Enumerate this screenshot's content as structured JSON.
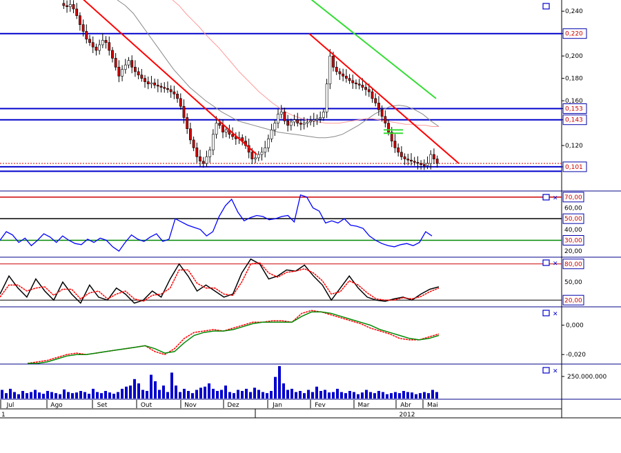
{
  "colors": {
    "price_up": "#ffffff",
    "price_down": "#cc0000",
    "candle_outline": "#000000",
    "support_resistance": "#0000cc",
    "trend_line": "#ff0000",
    "green_line": "#33dd33",
    "ma_fast": "#888888",
    "ma_slow": "#ff9999",
    "rsi_line": "#0000ff",
    "stoch_k": "#000000",
    "stoch_d": "#ff0000",
    "macd_line": "#ff0000",
    "signal_line": "#008800",
    "volume_bar": "#0000cc"
  },
  "icons": [
    "window-icon",
    "close-icon"
  ],
  "chart_data": [
    {
      "type": "candlestick",
      "panel": "price",
      "y_ticks": [
        "0,240",
        "0,220",
        "0,200",
        "0,180",
        "0,160",
        "0,153",
        "0,143",
        "0,120",
        "0,101"
      ],
      "price_labels": [
        {
          "value": "0,220",
          "boxed": true
        },
        {
          "value": "0,153",
          "boxed": true
        },
        {
          "value": "0,143",
          "boxed": true
        },
        {
          "value": "0,101",
          "boxed": true
        }
      ],
      "horizontal_levels": [
        0.22,
        0.153,
        0.143,
        0.101,
        0.097
      ],
      "ylim": [
        0.08,
        0.25
      ],
      "series": [
        {
          "values": [
            0.245,
            0.244,
            0.246,
            0.242,
            0.236,
            0.228,
            0.222,
            0.215,
            0.212,
            0.208,
            0.205,
            0.21,
            0.214,
            0.212,
            0.205,
            0.198,
            0.19,
            0.182,
            0.188,
            0.192,
            0.196,
            0.19,
            0.186,
            0.183,
            0.18,
            0.177,
            0.175,
            0.176,
            0.174,
            0.173,
            0.172,
            0.171,
            0.17,
            0.168,
            0.166,
            0.162,
            0.155,
            0.145,
            0.135,
            0.125,
            0.118,
            0.11,
            0.106,
            0.104,
            0.11,
            0.116,
            0.13,
            0.14,
            0.138,
            0.132,
            0.134,
            0.13,
            0.128,
            0.126,
            0.127,
            0.124,
            0.12,
            0.114,
            0.108,
            0.109,
            0.112,
            0.114,
            0.118,
            0.126,
            0.134,
            0.14,
            0.148,
            0.15,
            0.142,
            0.138,
            0.141,
            0.143,
            0.14,
            0.139,
            0.14,
            0.141,
            0.142,
            0.143,
            0.144,
            0.145,
            0.15,
            0.175,
            0.2,
            0.19,
            0.186,
            0.184,
            0.182,
            0.18,
            0.178,
            0.176,
            0.175,
            0.174,
            0.172,
            0.17,
            0.168,
            0.162,
            0.158,
            0.152,
            0.146,
            0.14,
            0.132,
            0.124,
            0.118,
            0.114,
            0.11,
            0.108,
            0.107,
            0.106,
            0.105,
            0.104,
            0.103,
            0.102,
            0.104,
            0.112,
            0.108,
            0.104
          ]
        }
      ],
      "moving_averages": [
        {
          "values": [
            0.25,
            0.245,
            0.238,
            0.228,
            0.218,
            0.208,
            0.198,
            0.188,
            0.18,
            0.172,
            0.166,
            0.16,
            0.155,
            0.15,
            0.146,
            0.142,
            0.14,
            0.138,
            0.136,
            0.134,
            0.132,
            0.131,
            0.13,
            0.129,
            0.128,
            0.127,
            0.127,
            0.128,
            0.13,
            0.134,
            0.138,
            0.143,
            0.148,
            0.152,
            0.155,
            0.156,
            0.155,
            0.152,
            0.148,
            0.142,
            0.137
          ]
        },
        {
          "values": [
            0.25,
            0.245,
            0.238,
            0.232,
            0.226,
            0.219,
            0.213,
            0.207,
            0.2,
            0.193,
            0.186,
            0.18,
            0.174,
            0.168,
            0.163,
            0.158,
            0.154,
            0.15,
            0.147,
            0.145,
            0.143,
            0.142,
            0.141,
            0.14,
            0.14,
            0.14,
            0.141,
            0.142,
            0.143,
            0.144,
            0.144,
            0.143,
            0.142,
            0.141,
            0.14,
            0.139,
            0.139,
            0.138,
            0.138,
            0.137,
            0.137
          ]
        }
      ]
    },
    {
      "type": "line",
      "panel": "rsi",
      "y_ticks": [
        "70,00",
        "60,00",
        "50,00",
        "40,00",
        "30,00",
        "20,00"
      ],
      "levels": [
        70,
        50,
        30
      ],
      "ylim": [
        15,
        75
      ],
      "values": [
        30,
        38,
        35,
        28,
        32,
        25,
        30,
        36,
        33,
        28,
        34,
        30,
        27,
        26,
        31,
        28,
        32,
        30,
        24,
        20,
        28,
        35,
        31,
        29,
        33,
        36,
        29,
        31,
        50,
        47,
        44,
        42,
        40,
        34,
        38,
        52,
        62,
        68,
        56,
        48,
        51,
        53,
        52,
        49,
        50,
        52,
        53,
        47,
        72,
        70,
        60,
        57,
        46,
        48,
        46,
        50,
        44,
        43,
        41,
        34,
        30,
        27,
        25,
        24,
        26,
        27,
        25,
        28,
        38,
        34
      ]
    },
    {
      "type": "line",
      "panel": "stochastic",
      "y_ticks": [
        "80,00",
        "50,00",
        "20,00"
      ],
      "levels": [
        80,
        20
      ],
      "ylim": [
        10,
        90
      ],
      "series": [
        {
          "name": "K",
          "values": [
            30,
            60,
            40,
            25,
            55,
            35,
            20,
            50,
            30,
            15,
            45,
            25,
            20,
            40,
            30,
            15,
            20,
            35,
            25,
            55,
            80,
            60,
            35,
            45,
            35,
            25,
            30,
            65,
            88,
            80,
            55,
            60,
            70,
            68,
            78,
            60,
            45,
            20,
            40,
            60,
            40,
            25,
            20,
            18,
            22,
            25,
            20,
            30,
            38,
            42
          ]
        },
        {
          "name": "D",
          "values": [
            25,
            45,
            45,
            35,
            40,
            42,
            28,
            38,
            38,
            22,
            32,
            35,
            22,
            30,
            35,
            22,
            18,
            28,
            30,
            40,
            70,
            70,
            48,
            40,
            40,
            30,
            28,
            50,
            80,
            82,
            65,
            58,
            66,
            68,
            72,
            65,
            52,
            30,
            34,
            52,
            45,
            32,
            22,
            20,
            20,
            24,
            22,
            26,
            34,
            40
          ]
        }
      ]
    },
    {
      "type": "line",
      "panel": "macd",
      "y_ticks": [
        "0,000",
        "-0,020"
      ],
      "ylim": [
        -0.026,
        0.012
      ],
      "series": [
        {
          "name": "MACD",
          "values": [
            -0.026,
            -0.025,
            -0.024,
            -0.022,
            -0.02,
            -0.019,
            -0.02,
            -0.019,
            -0.018,
            -0.017,
            -0.016,
            -0.015,
            -0.014,
            -0.018,
            -0.02,
            -0.016,
            -0.009,
            -0.005,
            -0.004,
            -0.003,
            -0.004,
            -0.002,
            0.0,
            0.002,
            0.002,
            0.003,
            0.003,
            0.002,
            0.008,
            0.01,
            0.009,
            0.007,
            0.005,
            0.003,
            0.001,
            -0.002,
            -0.004,
            -0.006,
            -0.009,
            -0.01,
            -0.01,
            -0.008,
            -0.006
          ]
        },
        {
          "name": "Signal",
          "values": [
            -0.026,
            -0.026,
            -0.025,
            -0.023,
            -0.021,
            -0.02,
            -0.02,
            -0.019,
            -0.018,
            -0.017,
            -0.016,
            -0.015,
            -0.014,
            -0.016,
            -0.019,
            -0.018,
            -0.012,
            -0.007,
            -0.005,
            -0.004,
            -0.004,
            -0.003,
            -0.001,
            0.001,
            0.002,
            0.002,
            0.002,
            0.002,
            0.006,
            0.009,
            0.009,
            0.008,
            0.006,
            0.004,
            0.002,
            0.0,
            -0.003,
            -0.005,
            -0.007,
            -0.009,
            -0.01,
            -0.009,
            -0.007
          ]
        }
      ]
    },
    {
      "type": "bar",
      "panel": "volume",
      "y_ticks": [
        "250.000.000"
      ],
      "values": [
        40,
        25,
        45,
        30,
        20,
        35,
        25,
        30,
        40,
        28,
        22,
        35,
        30,
        25,
        20,
        42,
        30,
        25,
        28,
        35,
        30,
        22,
        45,
        30,
        25,
        35,
        28,
        22,
        30,
        45,
        55,
        60,
        90,
        70,
        40,
        35,
        110,
        80,
        40,
        60,
        30,
        120,
        60,
        30,
        45,
        35,
        25,
        40,
        50,
        55,
        70,
        45,
        35,
        40,
        60,
        30,
        25,
        40,
        35,
        45,
        30,
        50,
        40,
        30,
        25,
        35,
        100,
        150,
        70,
        40,
        45,
        30,
        35,
        25,
        40,
        30,
        55,
        35,
        40,
        28,
        30,
        45,
        30,
        25,
        35,
        30,
        20,
        28,
        40,
        30,
        25,
        35,
        30,
        20,
        25,
        30,
        25,
        35,
        30,
        28,
        20,
        25,
        30,
        25,
        40,
        30
      ]
    }
  ],
  "x_axis": {
    "months": [
      "Jul",
      "Ago",
      "Set",
      "Out",
      "Nov",
      "Dez",
      "Jan",
      "Fev",
      "Mar",
      "Abr",
      "Mai"
    ],
    "years": [
      "1",
      "2012"
    ]
  }
}
